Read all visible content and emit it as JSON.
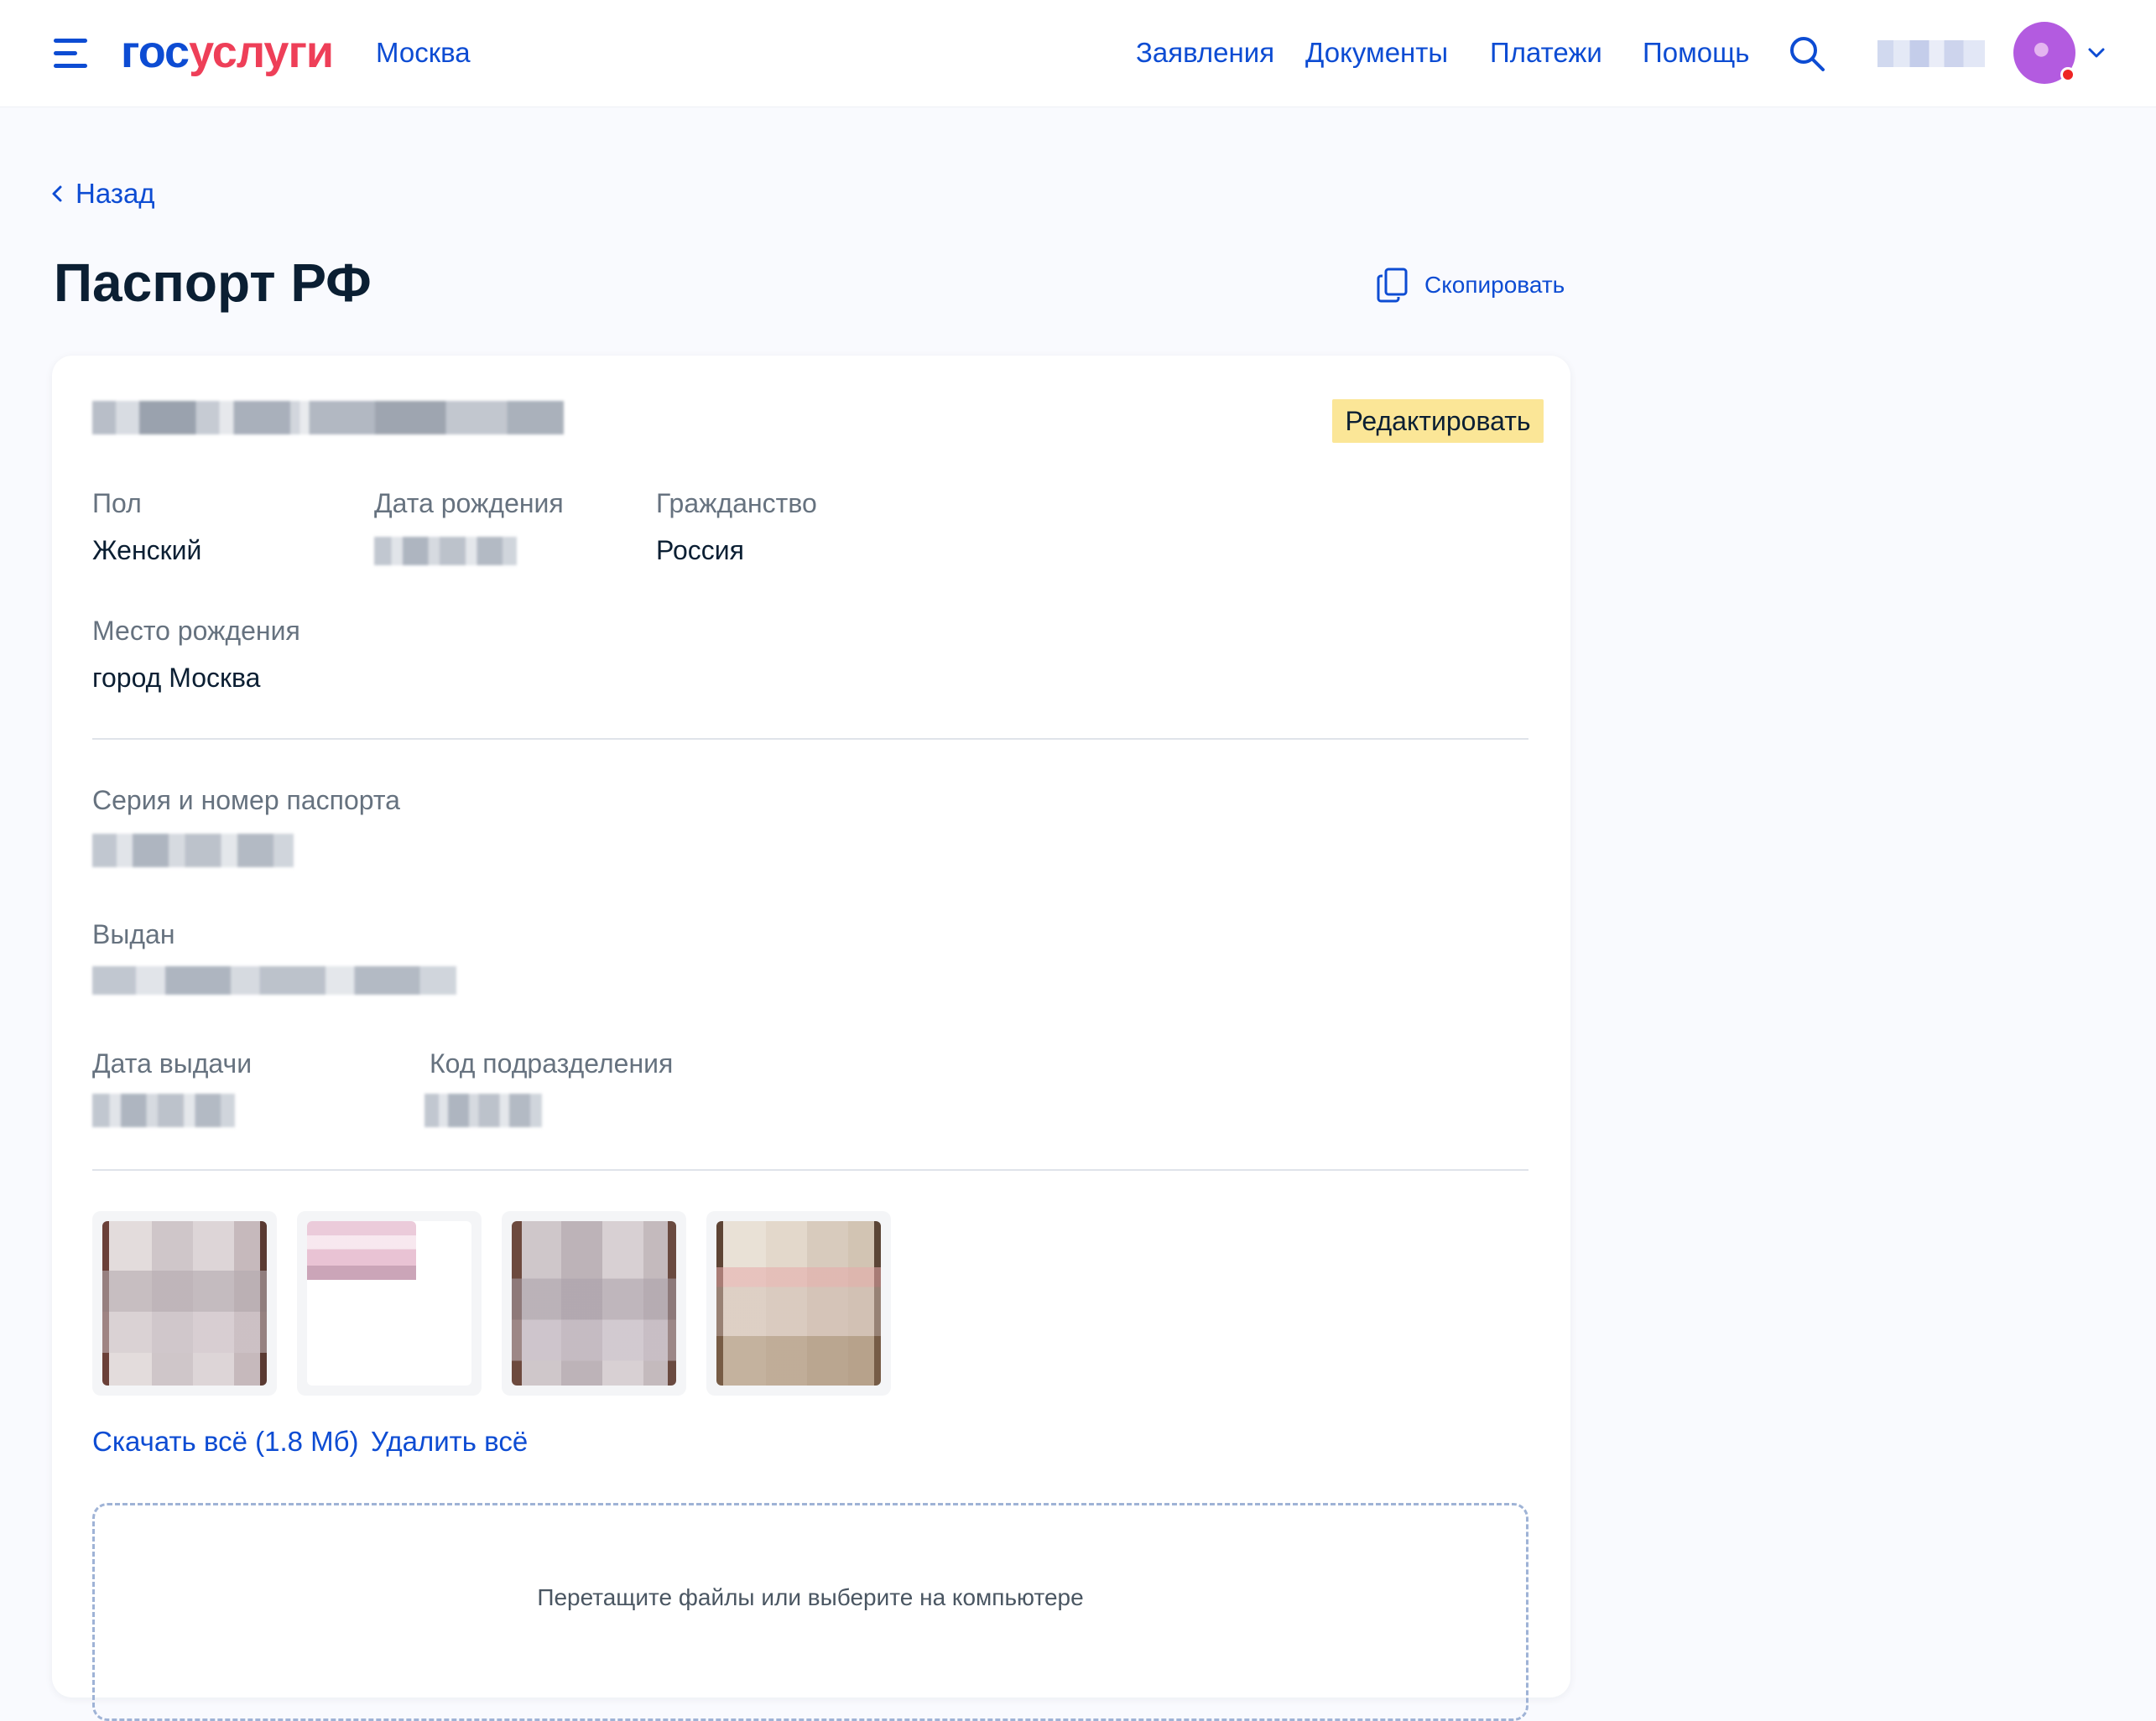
{
  "header": {
    "logo_part1": "гос",
    "logo_part2": "услуги",
    "city": "Москва",
    "nav": [
      "Заявления",
      "Документы",
      "Платежи",
      "Помощь"
    ],
    "icons": {
      "menu": "burger-menu-icon",
      "search": "search-icon",
      "profile_menu": "chevron-down-icon"
    }
  },
  "page": {
    "back_label": "Назад",
    "title": "Паспорт РФ",
    "copy_label": "Скопировать"
  },
  "card": {
    "edit_label": "Редактировать",
    "fields": {
      "gender_label": "Пол",
      "gender_value": "Женский",
      "birthdate_label": "Дата рождения",
      "citizenship_label": "Гражданство",
      "citizenship_value": "Россия",
      "birthplace_label": "Место рождения",
      "birthplace_value": "город Москва",
      "series_number_label": "Серия и номер паспорта",
      "issued_by_label": "Выдан",
      "issue_date_label": "Дата выдачи",
      "department_code_label": "Код подразделения"
    },
    "download_all": "Скачать всё (1.8 Мб)",
    "delete_all": "Удалить всё",
    "dropzone_text": "Перетащите файлы или выберите на компьютере"
  },
  "colors": {
    "accent": "#0d4cd3",
    "brand_red": "#ee3f58",
    "edit_button_bg": "#fbe697",
    "page_bg": "#f9fafe"
  }
}
